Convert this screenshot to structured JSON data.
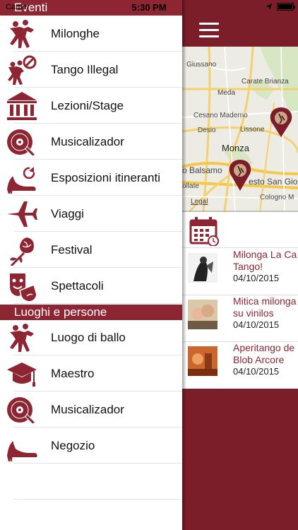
{
  "status_bar": {
    "carrier": "Carrier",
    "time": "5:30 PM",
    "battery_percent": 100
  },
  "menu": {
    "section_eventi": "Eventi",
    "section_luoghi": "Luoghi e persone",
    "eventi_items": [
      {
        "label": "Milonghe",
        "icon": "dancers-icon"
      },
      {
        "label": "Tango Illegal",
        "icon": "dancers-forbidden-icon"
      },
      {
        "label": "Lezioni/Stage",
        "icon": "building-columns-icon"
      },
      {
        "label": "Musicalizador",
        "icon": "vinyl-record-icon"
      },
      {
        "label": "Esposizioni itineranti",
        "icon": "heel-shoe-refresh-icon"
      },
      {
        "label": "Viaggi",
        "icon": "airplane-icon"
      },
      {
        "label": "Festival",
        "icon": "rose-icon"
      },
      {
        "label": "Spettacoli",
        "icon": "theater-mask-icon"
      }
    ],
    "luoghi_items": [
      {
        "label": "Luogo di ballo",
        "icon": "dancers-icon"
      },
      {
        "label": "Maestro",
        "icon": "graduation-cap-icon"
      },
      {
        "label": "Musicalizador",
        "icon": "vinyl-record-icon"
      },
      {
        "label": "Negozio",
        "icon": "heel-shoe-icon"
      }
    ]
  },
  "map": {
    "labels": [
      "Giussano",
      "Carate Brianza",
      "Meda",
      "Cesano Maderno",
      "Desio",
      "Lissone",
      "Monza",
      "o Balsamo",
      "esto San Gio",
      "ollate",
      "Cologno M",
      "Legal"
    ]
  },
  "events": [
    {
      "title_line1": "Milonga La Ca",
      "title_line2": "Tango!",
      "date": "04/10/2015"
    },
    {
      "title_line1": "Mitica milonga",
      "title_line2": "su vinilos",
      "date": "04/10/2015"
    },
    {
      "title_line1": "Aperitango de",
      "title_line2": "Blob Arcore",
      "date": "04/10/2015"
    }
  ],
  "colors": {
    "brand": "#8e2533",
    "brand_dark": "#7b1e2a"
  }
}
